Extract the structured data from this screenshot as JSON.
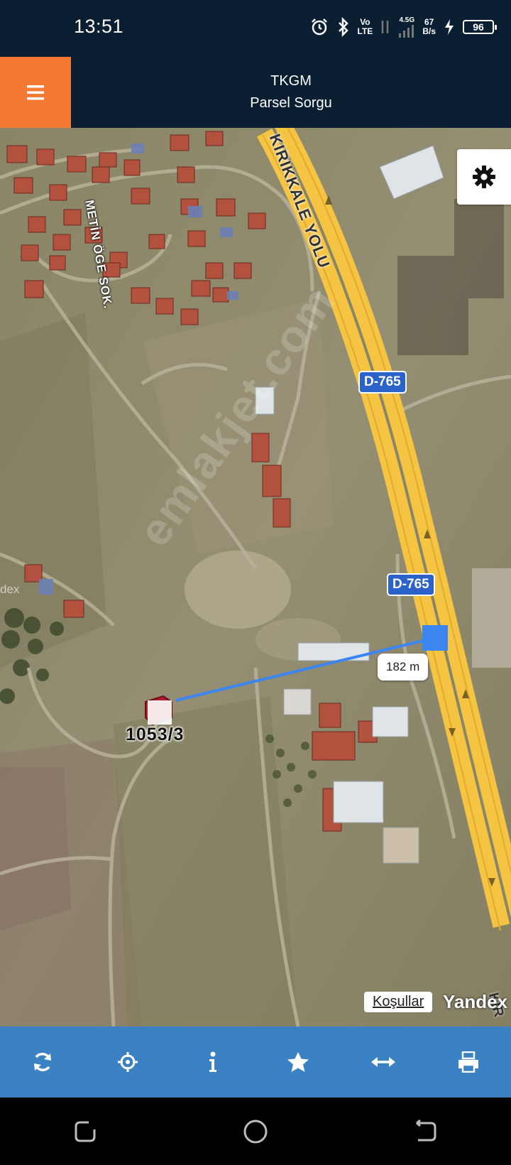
{
  "status_bar": {
    "time": "13:51",
    "network_volte": "Vo",
    "network_lte": "LTE",
    "network_gen": "4.5G",
    "speed_value": "67",
    "speed_unit": "B/s",
    "battery": "96"
  },
  "app_bar": {
    "title": "TKGM",
    "subtitle": "Parsel Sorgu"
  },
  "map": {
    "street_label_1": "METİN ÖGE SOK.",
    "road_name": "KIRIKKALE YOLU",
    "road_name_2": "KIR",
    "road_badge_1": "D-765",
    "road_badge_2": "D-765",
    "distance": "182 m",
    "parcel_number": "1053/3",
    "watermark": "emlakjet.com",
    "conditions_link": "Koşullar",
    "provider": "Yandex",
    "edge_text": "dex"
  },
  "toolbar": {
    "buttons": [
      "refresh-icon",
      "locate-icon",
      "info-icon",
      "star-icon",
      "measure-icon",
      "print-icon"
    ]
  },
  "colors": {
    "header_bg": "#0b1f33",
    "menu_accent": "#f47a33",
    "toolbar_bg": "#3b82c4",
    "road_yellow": "#f5c443",
    "distance_line": "#3b86f0"
  }
}
